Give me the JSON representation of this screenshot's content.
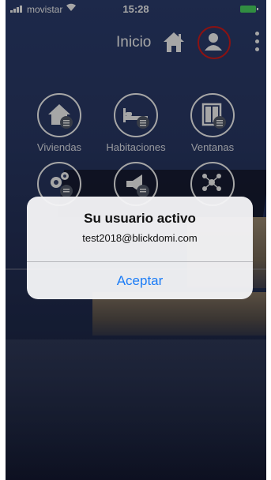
{
  "status_bar": {
    "carrier": "movistar",
    "time": "15:28"
  },
  "header": {
    "title": "Inicio"
  },
  "tiles": [
    {
      "label": "Viviendas",
      "icon": "house-icon"
    },
    {
      "label": "Habitaciones",
      "icon": "bed-icon"
    },
    {
      "label": "Ventanas",
      "icon": "window-icon"
    },
    {
      "label": "",
      "icon": "gears-icon"
    },
    {
      "label": "",
      "icon": "megaphone-icon"
    },
    {
      "label": "",
      "icon": "network-icon"
    }
  ],
  "alert": {
    "title": "Su usuario activo",
    "message": "test2018@blickdomi.com",
    "button_label": "Aceptar"
  },
  "colors": {
    "accent": "#1b7cf6",
    "highlight_circle": "#d61c1c",
    "battery": "#4cd964"
  }
}
